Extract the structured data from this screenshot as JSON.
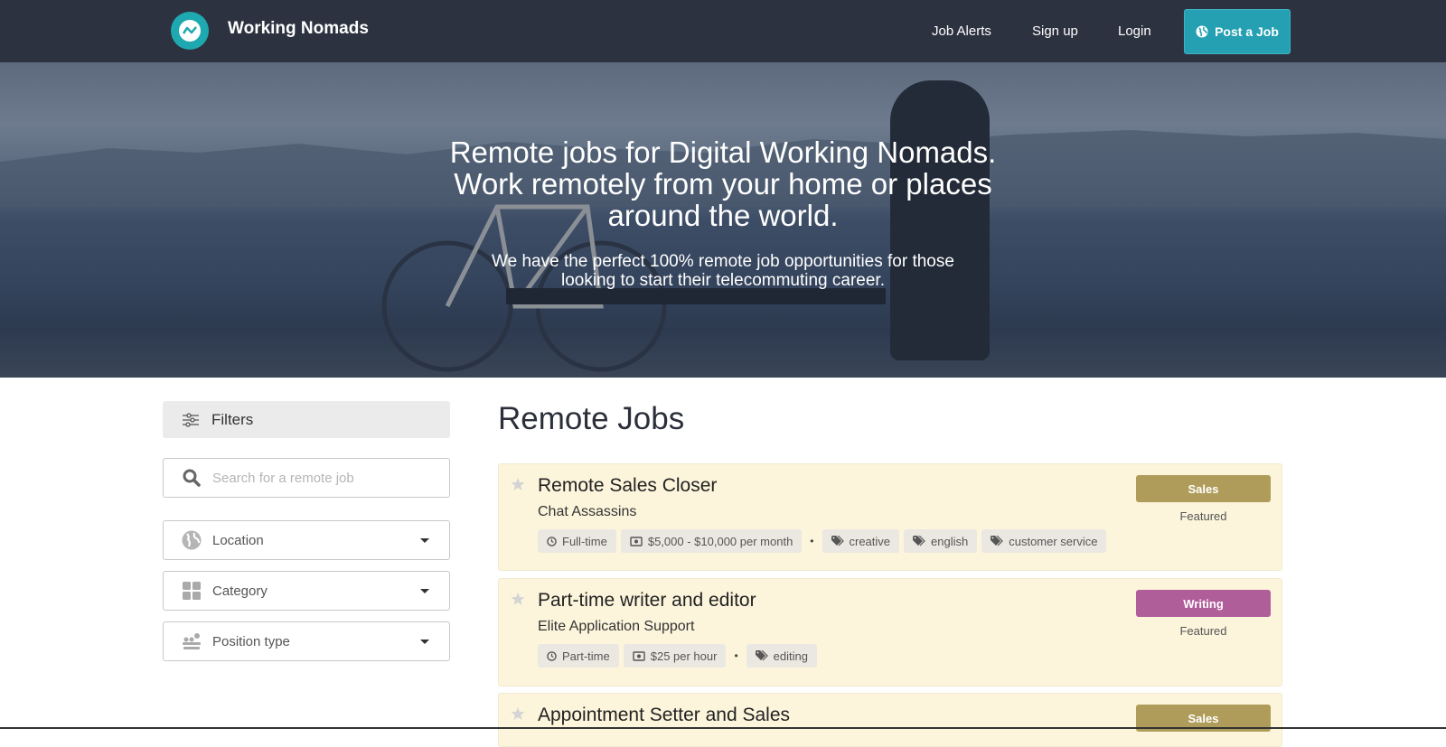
{
  "header": {
    "brand": "Working Nomads",
    "links": [
      "Job Alerts",
      "Sign up",
      "Login"
    ],
    "post_job": "Post a Job",
    "accent": "#25a0b3"
  },
  "hero": {
    "headline_lines": [
      "Remote jobs for Digital Working Nomads.",
      "Work remotely from your home or places",
      "around the world."
    ],
    "sub_lines": [
      "We have the perfect 100% remote job opportunities for those",
      "looking to start their telecommuting career."
    ]
  },
  "sidebar": {
    "filters_label": "Filters",
    "search_placeholder": "Search for a remote job",
    "location": "Location",
    "category": "Category",
    "position_type": "Position type"
  },
  "main": {
    "title": "Remote Jobs",
    "jobs": [
      {
        "title": "Remote Sales Closer",
        "company": "Chat Assassins",
        "type": "Full-time",
        "salary": "$5,000 - $10,000 per month",
        "tags": [
          "creative",
          "english",
          "customer service"
        ],
        "category": "Sales",
        "category_color": "#b09c5a",
        "featured": "Featured"
      },
      {
        "title": "Part-time writer and editor",
        "company": "Elite Application Support",
        "type": "Part-time",
        "salary": "$25 per hour",
        "tags": [
          "editing"
        ],
        "category": "Writing",
        "category_color": "#b05e9a",
        "featured": "Featured"
      },
      {
        "title": "Appointment Setter and Sales",
        "category": "Sales",
        "category_color": "#b09c5a"
      }
    ]
  }
}
